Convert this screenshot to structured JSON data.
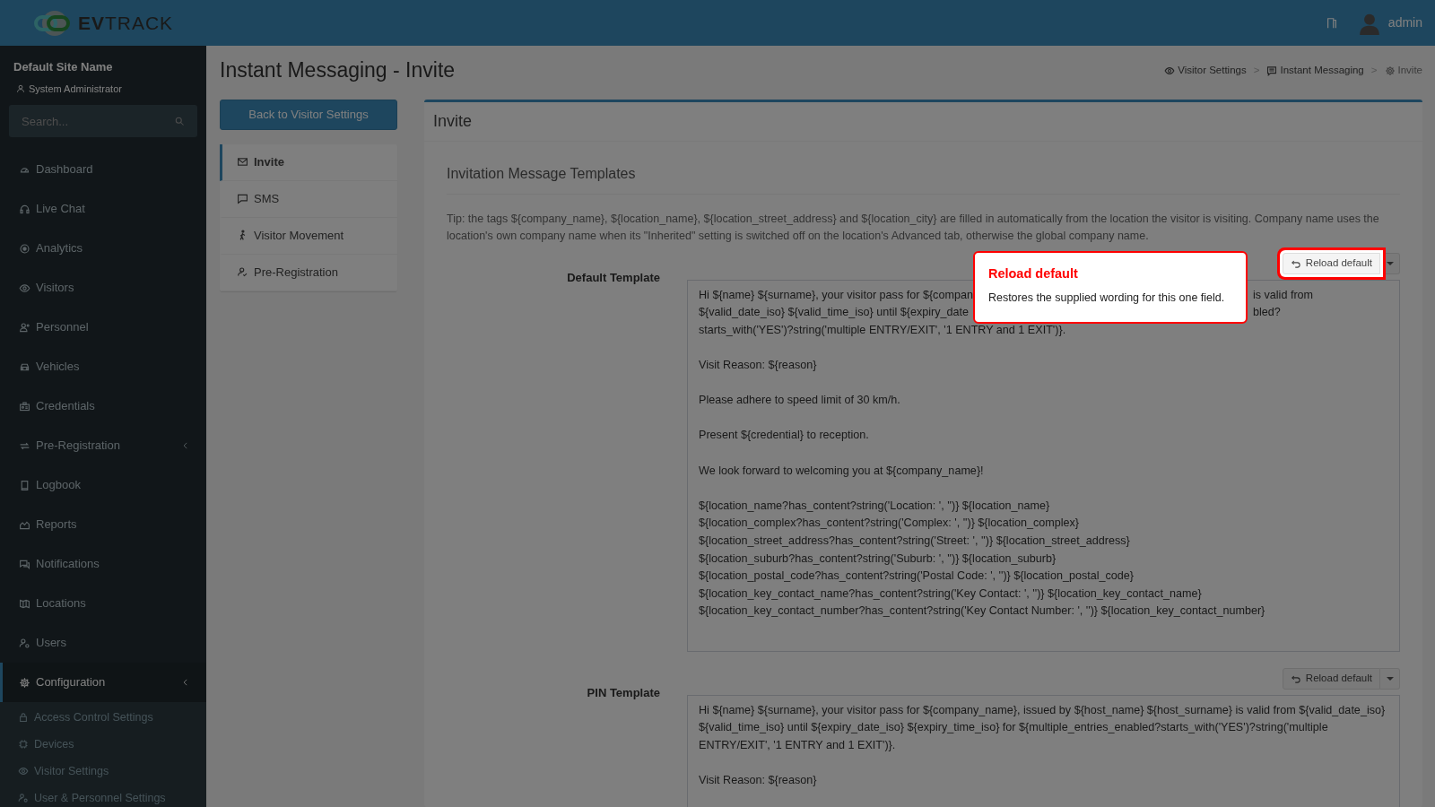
{
  "header": {
    "logo": "**EV**TRACK",
    "user": "admin"
  },
  "sidebar": {
    "site": "Default Site Name",
    "role": "System Administrator",
    "search_placeholder": "Search...",
    "items": [
      {
        "label": "Dashboard",
        "expandable": false,
        "selected": false
      },
      {
        "label": "Live Chat",
        "expandable": false,
        "selected": false
      },
      {
        "label": "Analytics",
        "expandable": false,
        "selected": false
      },
      {
        "label": "Visitors",
        "expandable": false,
        "selected": false
      },
      {
        "label": "Personnel",
        "expandable": false,
        "selected": false
      },
      {
        "label": "Vehicles",
        "expandable": false,
        "selected": false
      },
      {
        "label": "Credentials",
        "expandable": false,
        "selected": false
      },
      {
        "label": "Pre-Registration",
        "expandable": true,
        "selected": false
      },
      {
        "label": "Logbook",
        "expandable": false,
        "selected": false
      },
      {
        "label": "Reports",
        "expandable": false,
        "selected": false
      },
      {
        "label": "Notifications",
        "expandable": false,
        "selected": false
      },
      {
        "label": "Locations",
        "expandable": false,
        "selected": false
      },
      {
        "label": "Users",
        "expandable": false,
        "selected": false
      },
      {
        "label": "Configuration",
        "expandable": true,
        "selected": true,
        "children": [
          {
            "label": "Access Control Settings"
          },
          {
            "label": "Devices"
          },
          {
            "label": "Visitor Settings"
          },
          {
            "label": "User & Personnel Settings"
          }
        ]
      }
    ]
  },
  "page": {
    "title": "Instant Messaging - Invite",
    "breadcrumb": [
      {
        "kind": "link",
        "label": "Visitor Settings"
      },
      {
        "kind": "separator",
        "label": ">"
      },
      {
        "kind": "link",
        "label": "Instant Messaging"
      },
      {
        "kind": "separator",
        "label": ">"
      },
      {
        "kind": "current",
        "label": "Invite"
      }
    ],
    "back_button": "Back to Visitor Settings",
    "menu": [
      {
        "label": "Invite",
        "selected": true
      },
      {
        "label": "SMS",
        "selected": false
      },
      {
        "label": "Visitor Movement",
        "selected": false
      },
      {
        "label": "Pre-Registration",
        "selected": false
      }
    ]
  },
  "panel": {
    "title": "Invite",
    "section": "Invitation Message Templates",
    "tip": "Tip: the tags ${company_name}, ${location_name}, ${location_street_address} and ${location_city} are filled in automatically from the location the visitor is visiting. Company name uses the location's own company name when its \"Inherited\" setting is switched off on the location's Advanced tab, otherwise the global company name.",
    "templates": [
      {
        "label": "Default Template",
        "button": "Reload default",
        "highlighted": true,
        "paragraphs": [
          [
            {
              "before": "Hi ${name} ${surname}, your visitor pass for ${compan",
              "after": "is valid from"
            },
            {
              "before": "${valid_date_iso} ${valid_time_iso} until ${expiry_date",
              "after": "bled?"
            },
            "starts_with('YES')?string('multiple ENTRY/EXIT', '1 ENTRY and 1 EXIT')}."
          ],
          [
            "Visit Reason: ${reason}"
          ],
          [
            "Please adhere to speed limit of 30 km/h."
          ],
          [
            "Present ${credential} to reception."
          ],
          [
            "We look forward to welcoming you at ${company_name}!"
          ],
          [
            "${location_name?has_content?string('Location: ', '')} ${location_name}",
            "${location_complex?has_content?string('Complex: ', '')} ${location_complex}",
            "${location_street_address?has_content?string('Street: ', '')} ${location_street_address}",
            "${location_suburb?has_content?string('Suburb: ', '')} ${location_suburb}",
            "${location_postal_code?has_content?string('Postal Code: ', '')} ${location_postal_code}",
            "${location_key_contact_name?has_content?string('Key Contact: ', '')} ${location_key_contact_name}",
            "${location_key_contact_number?has_content?string('Key Contact Number: ', '')} ${location_key_contact_number}"
          ]
        ]
      },
      {
        "label": "PIN Template",
        "button": "Reload default",
        "highlighted": false,
        "value": "Hi ${name} ${surname}, your visitor pass for ${company_name}, issued by ${host_name} ${host_surname} is valid from ${valid_date_iso} ${valid_time_iso} until ${expiry_date_iso} ${expiry_time_iso} for ${multiple_entries_enabled?starts_with('YES')?string('multiple ENTRY/EXIT', '1 ENTRY and 1 EXIT')}.\n\nVisit Reason: ${reason}"
      }
    ]
  },
  "tour": {
    "title": "Reload default",
    "text": "Restores the supplied wording for this one field."
  }
}
